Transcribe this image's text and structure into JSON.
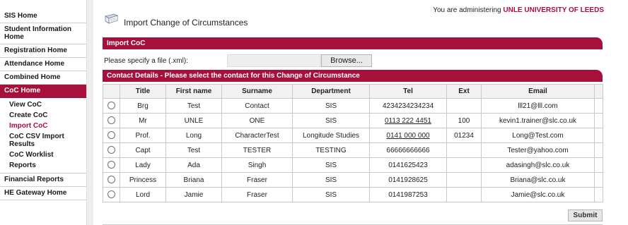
{
  "sidebar": {
    "items": [
      {
        "label": "SIS Home"
      },
      {
        "label": "Student Information Home"
      },
      {
        "label": "Registration Home"
      },
      {
        "label": "Attendance Home"
      },
      {
        "label": "Combined Home"
      },
      {
        "label": "CoC Home"
      }
    ],
    "coc_sub": [
      {
        "label": "View CoC"
      },
      {
        "label": "Create CoC"
      },
      {
        "label": "Import CoC"
      },
      {
        "label": "CoC CSV Import Results"
      },
      {
        "label": "CoC Worklist"
      },
      {
        "label": "Reports"
      }
    ],
    "bottom_items": [
      {
        "label": "Financial Reports"
      },
      {
        "label": "HE Gateway Home"
      }
    ]
  },
  "header": {
    "admin_prefix": "You are administering",
    "university": "UNLE UNIVERSITY OF LEEDS",
    "title": "Import Change of Circumstances"
  },
  "import_panel": {
    "title": "Import CoC",
    "file_label": "Please specify a file (.xml):",
    "browse_label": "Browse..."
  },
  "contact_panel": {
    "title": "Contact Details - Please select the contact for this Change of Circumstance"
  },
  "table": {
    "headers": [
      "",
      "Title",
      "First name",
      "Surname",
      "Department",
      "Tel",
      "Ext",
      "Email",
      ""
    ],
    "rows": [
      {
        "title": "Brg",
        "first": "Test",
        "surname": "Contact",
        "dept": "SIS",
        "tel": "4234234234234",
        "ext": "",
        "email": "lll21@lll.com"
      },
      {
        "title": "Mr",
        "first": "UNLE",
        "surname": "ONE",
        "dept": "SIS",
        "tel": "0113 222 4451",
        "ext": "100",
        "email": "kevin1.trainer@slc.co.uk"
      },
      {
        "title": "Prof.",
        "first": "Long",
        "surname": "CharacterTest",
        "dept": "Longitude Studies",
        "tel": "0141 000 000",
        "ext": "01234",
        "email": "Long@Test.com"
      },
      {
        "title": "Capt",
        "first": "Test",
        "surname": "TESTER",
        "dept": "TESTING",
        "tel": "66666666666",
        "ext": "",
        "email": "Tester@yahoo.com"
      },
      {
        "title": "Lady",
        "first": "Ada",
        "surname": "Singh",
        "dept": "SIS",
        "tel": "0141625423",
        "ext": "",
        "email": "adasingh@slc.co.uk"
      },
      {
        "title": "Princess",
        "first": "Briana",
        "surname": "Fraser",
        "dept": "SIS",
        "tel": "0141928625",
        "ext": "",
        "email": "Briana@slc.co.uk"
      },
      {
        "title": "Lord",
        "first": "Jamie",
        "surname": "Fraser",
        "dept": "SIS",
        "tel": "0141987253",
        "ext": "",
        "email": "Jamie@slc.co.uk"
      }
    ]
  },
  "submit_label": "Submit",
  "colors": {
    "accent": "#a8103c"
  }
}
